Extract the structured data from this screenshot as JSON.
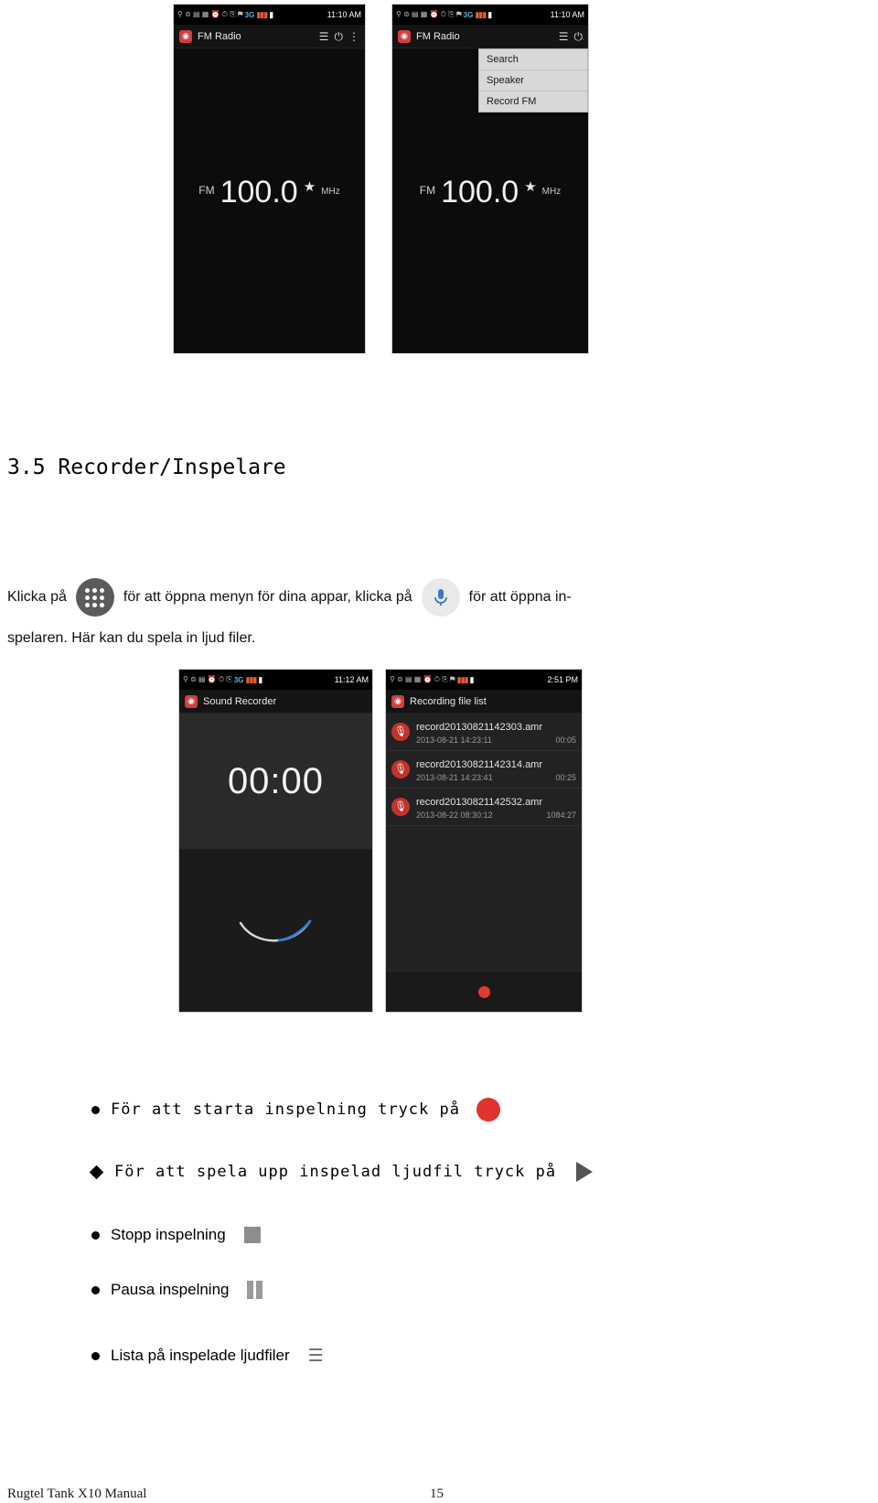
{
  "doc": {
    "heading": "3.5 Recorder/Inspelare",
    "para1_a": "Klicka på",
    "para1_b": "för att öppna menyn för dina appar, klicka på",
    "para1_c": "för att öppna in-",
    "para2": "spelaren. Här kan du spela in ljud filer.",
    "footer_left": "Rugtel Tank X10 Manual",
    "footer_page": "15"
  },
  "bullets": [
    {
      "text": "För att starta inspelning tryck på",
      "icon": "record-dot-icon",
      "style": "mono"
    },
    {
      "text": "För att spela upp inspelad ljudfil tryck på",
      "icon": "play-triangle-icon",
      "style": "mono"
    },
    {
      "text": "Stopp inspelning",
      "icon": "stop-square-icon",
      "style": "sans"
    },
    {
      "text": "Pausa inspelning",
      "icon": "pause-bars-icon",
      "style": "sans"
    },
    {
      "text": "Lista på inspelade ljudfiler",
      "icon": "list-icon",
      "style": "sans"
    }
  ],
  "screens": {
    "fm1": {
      "status_icons": "⚲ ⊜ ▤ ▦ ⏰ ⏱ ⎘ ⚑",
      "status_net": "G.ıl",
      "status_3g": "3G",
      "status_bars": "▮▮▮",
      "status_battery": "▮",
      "status_time": "11:10 AM",
      "app_title": "FM Radio",
      "icon_list": "list-icon",
      "icon_power": "power-icon",
      "icon_more": "overflow-menu-icon",
      "fm_label": "FM",
      "frequency": "100.0",
      "star": "★",
      "unit": "MHz",
      "controls": [
        "prev-station-icon",
        "tune-down-icon",
        "tune-up-icon",
        "next-station-icon"
      ]
    },
    "fm2": {
      "status_icons": "⚲ ⊜ ▤ ▦ ⏰ ⏱ ⎘ ⚑",
      "status_3g": "3G",
      "status_time": "11:10 AM",
      "app_title": "FM Radio",
      "fm_label": "FM",
      "frequency": "100.0",
      "star": "★",
      "unit": "MHz",
      "menu": [
        "Search",
        "Speaker",
        "Record FM"
      ],
      "controls": [
        "prev-station-icon",
        "tune-down-icon",
        "tune-up-icon",
        "next-station-icon"
      ]
    },
    "recorder": {
      "status_icons": "⚲ ⊜ ▤ ⏰ ⏱ ⎘",
      "status_3g": "3G",
      "status_time": "11:12 AM",
      "app_title": "Sound Recorder",
      "timer": "00:00",
      "record_button": "record-dot-icon",
      "list_button": "list-icon"
    },
    "filelist": {
      "status_icons": "⚲ ⊜ ▤ ▦ ⏰ ⏱ ⎘ ⚑",
      "status_time": "2:51 PM",
      "app_title": "Recording file list",
      "rows": [
        {
          "name": "record20130821142303.amr",
          "date": "2013-08-21 14:23:11",
          "size": "00:05"
        },
        {
          "name": "record20130821142314.amr",
          "date": "2013-08-21 14:23:41",
          "size": "00:25"
        },
        {
          "name": "record20130821142532.amr",
          "date": "2013-08-22 08:30:12",
          "size": "1084:27"
        }
      ],
      "record_button": "record-dot-icon"
    }
  }
}
